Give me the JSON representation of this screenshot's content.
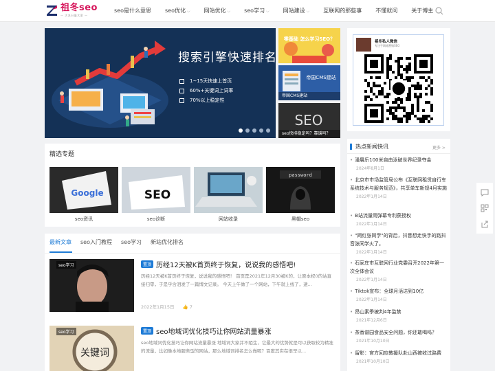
{
  "logo": {
    "title": "祖冬seo",
    "subtitle": "— 大名分量大家 —"
  },
  "nav": [
    {
      "label": "seo是什么意思",
      "dropdown": false
    },
    {
      "label": "seo优化",
      "dropdown": true
    },
    {
      "label": "网站优化",
      "dropdown": true
    },
    {
      "label": "seo学习",
      "dropdown": true
    },
    {
      "label": "网站建设",
      "dropdown": true
    },
    {
      "label": "互联网的那些事",
      "dropdown": false
    },
    {
      "label": "不懂就问",
      "dropdown": false
    },
    {
      "label": "关于博主",
      "dropdown": false
    }
  ],
  "banner": {
    "title": "搜索引擎快速排名",
    "bullets": [
      "1~15天快速上首页",
      "60%+关键词上词率",
      "70%以上稳定性"
    ],
    "slide_count": 5,
    "active_slide": 1
  },
  "side_thumbs": [
    {
      "caption": "",
      "art": "零基础 怎么学习SEO？"
    },
    {
      "caption": "帝国CMS建站",
      "art": "帝国CMS建站"
    },
    {
      "caption": "seo快排稳定吗？靠谱吗？",
      "art": "SEO"
    }
  ],
  "featured": {
    "title": "精选专题",
    "items": [
      {
        "label": "seo资讯",
        "art": "Google"
      },
      {
        "label": "seo诊断",
        "art": "SEO"
      },
      {
        "label": "网站收录",
        "art": ""
      },
      {
        "label": "黑帽seo",
        "art": "password"
      }
    ]
  },
  "tabs": [
    "最新文章",
    "seo入门教程",
    "seo学习",
    "新站优化排名"
  ],
  "articles": [
    {
      "tag": "seo学习",
      "badge": "置顶",
      "title": "历经12天被K首页终于恢复，说说我的感悟吧!",
      "summary": "历经12天被K首页终于恢复，说说我的感悟吧！ 首页是2021年12月30被K的，让原本权0的站直接归零，于是乎含泪发了一篇博文记录。 今天上午做了一个网站，下午就上线了，逮...",
      "date": "2022年1月15日",
      "likes": "7"
    },
    {
      "tag": "seo学习",
      "badge": "置顶",
      "title": "seo地域词优化技巧让你网站流量暴涨",
      "summary": "seo地域词优化技巧让你网站流量暴涨 地域词大家并不陌生，它最大的优势就是可以获取较为精准的流量，比如像本地服务型的网站，那么地域词排名怎么做呢？百度其实在很早以...",
      "date": "",
      "likes": ""
    }
  ],
  "qr": {
    "name": "祖冬私人微信",
    "sub": "专注于网络营销SEO"
  },
  "news": {
    "title": "热点新闻快讯",
    "more": "更多 >",
    "items": [
      {
        "text": "潘展乐100米自由泳破世界纪录夺金",
        "date": "2024年8月1日"
      },
      {
        "text": "北京市市场监管局公布《互联网租赁自行车系统技术与服务规范》，共享单车新规4月实施",
        "date": "2022年1月14日"
      },
      {
        "text": "B站流量雨弹幕专利获授权",
        "date": "2022年1月14日"
      },
      {
        "text": "\"网红张同学\"的背后，抖音想走快手的路抖音张同学火了。",
        "date": "2022年1月14日"
      },
      {
        "text": "石家庄市互联网行业党委召开2022年第一次全体会议",
        "date": "2022年1月14日"
      },
      {
        "text": "Tiktok宣布：全球月活达到10亿",
        "date": "2022年1月14日"
      },
      {
        "text": "昂山素季被判4年监禁",
        "date": "2021年12月6日"
      },
      {
        "text": "茶香谱园食品安全问题，你还敢喝吗？",
        "date": "2021年10月10日"
      },
      {
        "text": "留影：官方回应教援队赴山西被收过路费",
        "date": "2021年10月10日"
      }
    ]
  },
  "colors": {
    "accent": "#1e7bd6",
    "brand": "#d6145a",
    "banner_bg": "#143156"
  }
}
